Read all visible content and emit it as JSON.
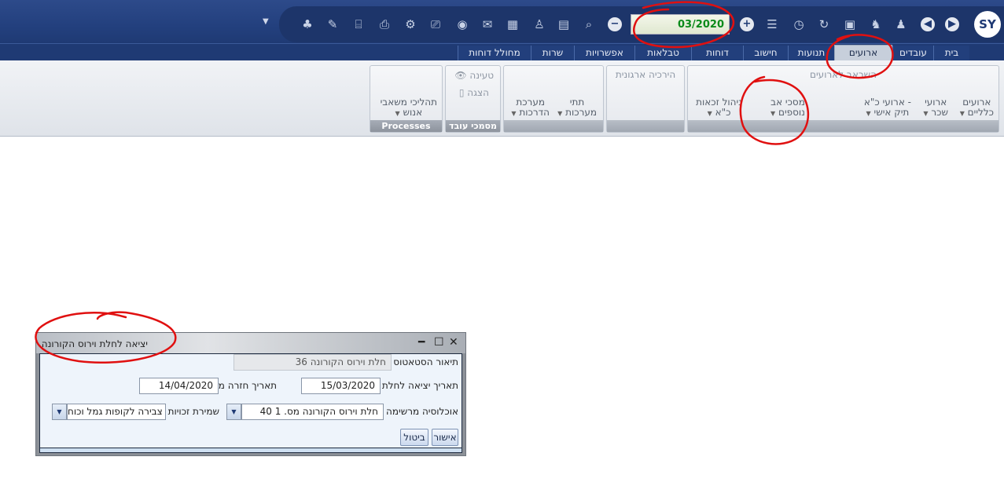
{
  "toolbar": {
    "logo_text": "SY",
    "period_value": "03/2020",
    "icons": [
      "nav-forward-icon",
      "nav-back-icon",
      "users-icon",
      "users-swap-icon",
      "save-icon",
      "refresh-icon",
      "history-icon",
      "list-icon",
      "add-icon",
      "remove-icon",
      "search-icon",
      "report-icon",
      "user-sum-icon",
      "user-card-icon",
      "mail-icon",
      "mouse-icon",
      "preview-icon",
      "settings-icon",
      "print-icon",
      "search-doc-icon",
      "edit-user-icon",
      "tree-icon",
      "dropdown-icon"
    ]
  },
  "tabs": [
    {
      "label": "בית"
    },
    {
      "label": "עובדים"
    },
    {
      "label": "ארועים",
      "active": true
    },
    {
      "label": "תנועות"
    },
    {
      "label": "חישוב"
    },
    {
      "label": "דוחות"
    },
    {
      "label": "טבלאות"
    },
    {
      "label": "אפשרויות"
    },
    {
      "label": "שרות"
    },
    {
      "label": "מחולל דוחות"
    }
  ],
  "ribbon": {
    "events_group_head": "השראב לארועים",
    "btn_general_events": [
      "ארועים",
      "כלליים"
    ],
    "btn_salary_events": [
      "ארועי",
      "שכר"
    ],
    "btn_hr_events": [
      "ארועי כ\"א -",
      "תיק אישי"
    ],
    "btn_more_agreements": [
      "מסכי אב",
      "נוספים"
    ],
    "btn_rights_mgmt": [
      "ניהול זכאות",
      "כ\"א"
    ],
    "org_hierarchy_head": "הירכיה ארגונית",
    "btn_subsystems": [
      "תתי",
      "מערכות"
    ],
    "btn_training": [
      "מערכת",
      "הדרכות"
    ],
    "loading_label": "טעינה",
    "display_label": "הצגה",
    "employee_docs_title": "מסמכי עובד",
    "btn_hr_processes": [
      "תהליכי משאבי",
      "אנוש"
    ],
    "processes_title": "Processes"
  },
  "dialog": {
    "title": "יציאה לחלת וירוס הקורונה",
    "status_desc_label": "תיאור הסטאטוס",
    "status_desc_value": "36 חלת וירוס הקורונה",
    "exit_date_label": "תאריך יציאה לחלת",
    "exit_date_value": "15/03/2020",
    "return_date_label": "תאריך חזרה מחלת",
    "return_date_value": "14/04/2020",
    "population_label": "אוכלוסיה מרשימה",
    "population_value": "40 חלת וירוס הקורונה מס. 1",
    "rights_label": "שמירת זכויות",
    "rights_value": "צבירה לקופות גמל וכוח",
    "ok_label": "אישור",
    "cancel_label": "ביטול"
  },
  "colors": {
    "header": "#23407e",
    "period_text": "#0a8a1a",
    "annotation": "#e01010"
  }
}
